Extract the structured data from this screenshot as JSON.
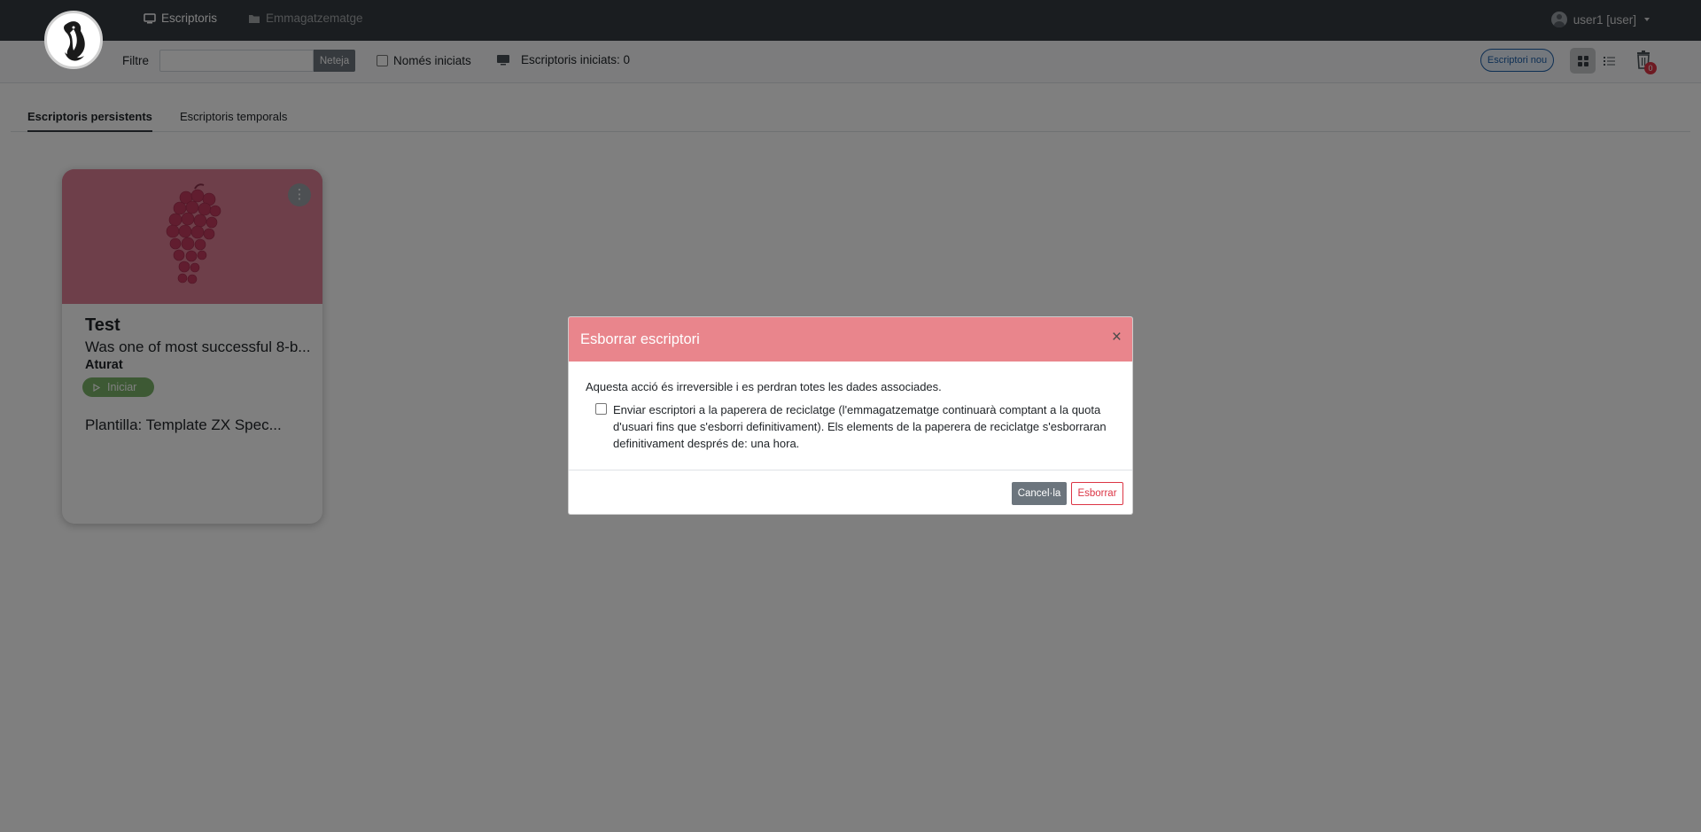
{
  "navbar": {
    "desktops_label": "Escriptoris",
    "storage_label": "Emmagatzematge",
    "user_label": "user1 [user]"
  },
  "filterbar": {
    "filter_label": "Filtre",
    "filter_value": "",
    "clear_label": "Neteja",
    "only_started_label": "Només iniciats",
    "started_count_label": "Escriptoris iniciats: 0",
    "new_desktop_label": "Escriptori nou",
    "trash_count": "0"
  },
  "tabs": [
    {
      "label": "Escriptoris persistents",
      "active": true
    },
    {
      "label": "Escriptoris temporals",
      "active": false
    }
  ],
  "desktop_card": {
    "name": "Test",
    "description": "Was one of most successful 8-b...",
    "state": "Aturat",
    "start_label": "Iniciar",
    "template": "Plantilla: Template ZX Spec..."
  },
  "modal": {
    "title": "Esborrar escriptori",
    "close_symbol": "×",
    "warning": "Aquesta acció és irreversible i es perdran totes les dades associades.",
    "recycle_text": "Enviar escriptori a la paperera de reciclatge (l'emmagatzematge continuarà comptant a la quota d'usuari fins que s'esborri definitivament). Els elements de la paperera de reciclatge s'esborraran definitivament després de: una hora.",
    "recycle_checked": false,
    "cancel_label": "Cancel·la",
    "delete_label": "Esborrar"
  },
  "colors": {
    "navbar": "#343a40",
    "modal_header": "#e9858c",
    "danger": "#dc3545",
    "secondary": "#6c757d",
    "primary": "#1d5fa8",
    "card_image": "#dc7f94",
    "start_button": "#7ab369"
  },
  "icons": {
    "logo": "penguin-logo",
    "desktops": "monitor-icon",
    "storage": "folder-icon",
    "user": "user-avatar-icon",
    "started": "monitor-icon",
    "grid_view": "grid-icon",
    "list_view": "list-icon",
    "trash": "trash-icon",
    "card_menu": "kebab-menu-icon",
    "start": "play-icon",
    "close": "close-icon"
  }
}
